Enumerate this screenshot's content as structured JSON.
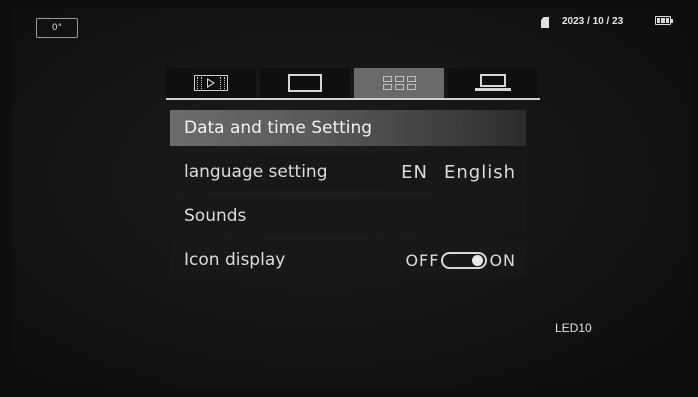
{
  "status_bar": {
    "angle": "0°",
    "sd_icon": "sd-card-icon",
    "date": "2023 / 10 / 23",
    "battery_icon": "battery-icon"
  },
  "tabs": [
    {
      "name": "video-playback",
      "icon": "video-playback-icon",
      "active": false
    },
    {
      "name": "display-frame",
      "icon": "frame-icon",
      "active": false
    },
    {
      "name": "grid-settings",
      "icon": "grid-icon",
      "active": true
    },
    {
      "name": "system",
      "icon": "laptop-icon",
      "active": false
    }
  ],
  "menu": [
    {
      "label": "Data and time Setting",
      "selected": true
    },
    {
      "label": "language setting",
      "value_code": "EN",
      "value_name": "English"
    },
    {
      "label": "Sounds"
    },
    {
      "label": "Icon display",
      "toggle_off": "OFF",
      "toggle_on": "ON",
      "state": "ON"
    }
  ],
  "footer": {
    "led_label": "LED10"
  },
  "colors": {
    "background": "#0e0e0e",
    "tab_active": "#6a6a6a",
    "selected_row": "#6b6b6b",
    "text": "#e6e6e6"
  }
}
